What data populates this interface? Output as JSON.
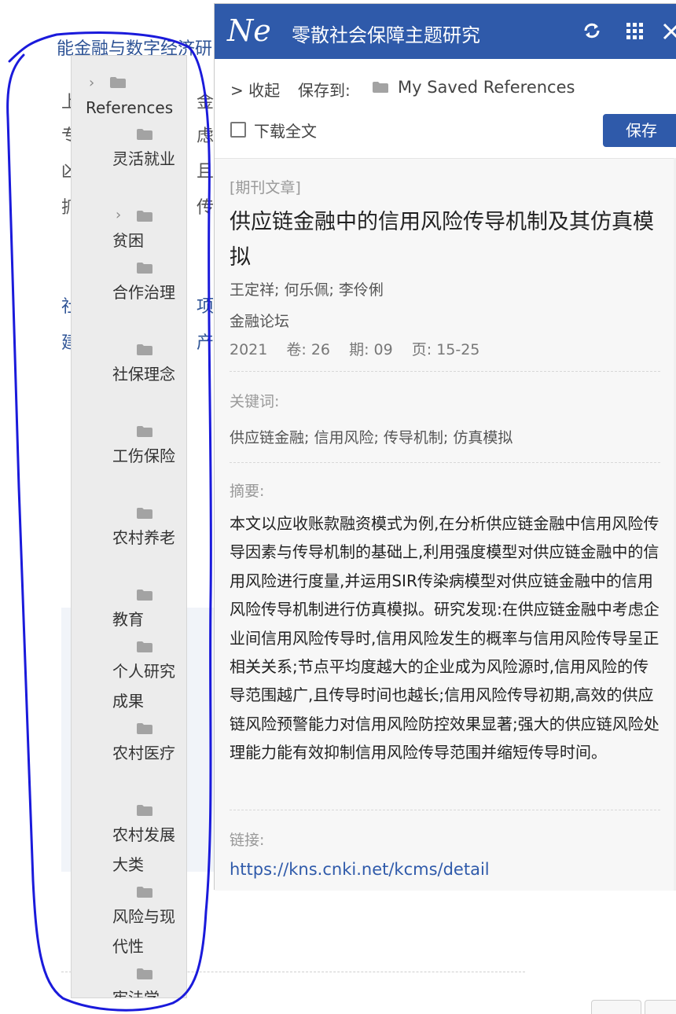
{
  "background_page": {
    "title": "能金融与数字经济研",
    "lines": [
      {
        "text": "上",
        "suffix": "金对"
      },
      {
        "text": "专",
        "suffix": "虑企"
      },
      {
        "text": "凶",
        "suffix": "且作"
      },
      {
        "text": "抓",
        "suffix": "传导"
      }
    ],
    "blue_lines": [
      {
        "text": "社",
        "suffix": "项目"
      },
      {
        "text": "建",
        "suffix": "产业"
      }
    ]
  },
  "folder_tree": {
    "root_label": "References",
    "items": [
      {
        "label": "灵活就业",
        "expandable": false
      },
      {
        "label": "贫困",
        "expandable": true
      },
      {
        "label": "合作治理",
        "expandable": false
      },
      {
        "label": "社保理念",
        "expandable": false
      },
      {
        "label": "工伤保险",
        "expandable": false
      },
      {
        "label": "农村养老",
        "expandable": false
      },
      {
        "label": "教育",
        "expandable": false
      },
      {
        "label": "个人研究成果",
        "expandable": false
      },
      {
        "label": "农村医疗",
        "expandable": false
      },
      {
        "label": "农村发展大类",
        "expandable": false
      },
      {
        "label": "风险与现代性",
        "expandable": false
      },
      {
        "label": "宪法学",
        "expandable": false
      }
    ]
  },
  "popup": {
    "logo": "Ne",
    "header_title": "零散社会保障主题研究",
    "collapse_label": "> 收起",
    "save_to_label": "保存到:",
    "save_to_value": "My Saved References",
    "download_label": "下载全文",
    "save_button": "保存",
    "record": {
      "type": "[期刊文章]",
      "title": "供应链金融中的信用风险传导机制及其仿真模拟",
      "authors": "王定祥; 何乐佩; 李伶俐",
      "journal": "金融论坛",
      "year": "2021",
      "volume": "卷: 26",
      "issue": "期: 09",
      "pages": "页: 15-25",
      "keywords_label": "关键词:",
      "keywords": "供应链金融; 信用风险; 传导机制; 仿真模拟",
      "abstract_label": "摘要:",
      "abstract": "本文以应收账款融资模式为例,在分析供应链金融中信用风险传导因素与传导机制的基础上,利用强度模型对供应链金融中的信用风险进行度量,并运用SIR传染病模型对供应链金融中的信用风险传导机制进行仿真模拟。研究发现:在供应链金融中考虑企业间信用风险传导时,信用风险发生的概率与信用风险传导呈正相关关系;节点平均度越大的企业成为风险源时,信用风险的传导范围越广,且传导时间也越长;信用风险传导初期,高效的供应链风险预警能力对信用风险防控效果显著;强大的供应链风险处理能力能有效抑制信用风险传导范围并缩短传导时间。",
      "link_label": "链接:",
      "link": "https://kns.cnki.net/kcms/detail"
    }
  },
  "colors": {
    "header": "#2f5aaa",
    "annotation": "#1a1adb",
    "link": "#2f5aaa"
  },
  "icons": {
    "refresh": "refresh-icon",
    "grid": "grid-icon",
    "close": "close-icon",
    "folder": "folder-icon",
    "chevron": "chevron-right-icon"
  }
}
